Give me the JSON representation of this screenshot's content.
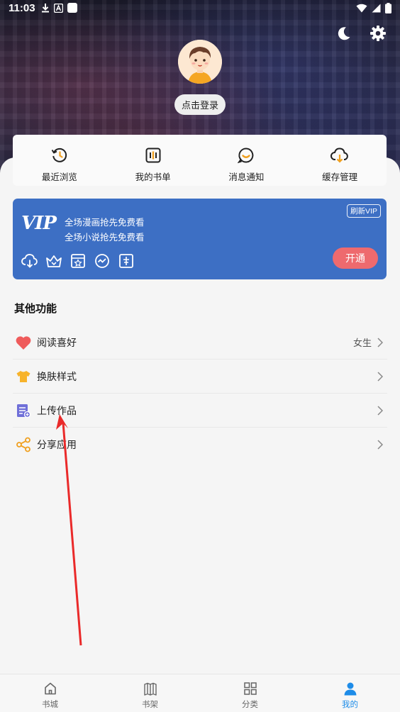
{
  "status_bar": {
    "time": "11:03",
    "left_icons": [
      "download-icon",
      "a-box-icon",
      "white-square-icon"
    ],
    "right_icons": [
      "wifi-icon",
      "signal-icon",
      "battery-icon"
    ]
  },
  "header": {
    "night_mode_icon": "moon-icon",
    "settings_icon": "gear-icon",
    "login_label": "点击登录"
  },
  "quick_actions": [
    {
      "label": "最近浏览",
      "icon": "history-clock-icon"
    },
    {
      "label": "我的书单",
      "icon": "booklist-icon"
    },
    {
      "label": "消息通知",
      "icon": "message-bubble-icon"
    },
    {
      "label": "缓存管理",
      "icon": "cloud-download-icon"
    }
  ],
  "vip": {
    "logo": "VIP",
    "line1": "全场漫画抢先免费看",
    "line2": "全场小说抢先免费看",
    "refresh_label": "刷新VIP",
    "open_label": "开通",
    "icons": [
      "cloud-download-icon",
      "crown-icon",
      "star-box-icon",
      "chart-circle-icon",
      "badge-icon"
    ],
    "colors": {
      "card": "#3d6fc4",
      "button": "#ee6a6e"
    }
  },
  "other_section": {
    "title": "其他功能",
    "items": [
      {
        "label": "阅读喜好",
        "value": "女生",
        "icon": "heart-icon"
      },
      {
        "label": "换肤样式",
        "value": "",
        "icon": "tshirt-icon"
      },
      {
        "label": "上传作品",
        "value": "",
        "icon": "upload-document-icon"
      },
      {
        "label": "分享应用",
        "value": "",
        "icon": "share-icon"
      }
    ]
  },
  "tabbar": {
    "items": [
      {
        "label": "书城",
        "icon": "home-icon",
        "active": false
      },
      {
        "label": "书架",
        "icon": "bookshelf-icon",
        "active": false
      },
      {
        "label": "分类",
        "icon": "category-grid-icon",
        "active": false
      },
      {
        "label": "我的",
        "icon": "user-icon",
        "active": true
      }
    ],
    "active_color": "#1e8ce8"
  }
}
